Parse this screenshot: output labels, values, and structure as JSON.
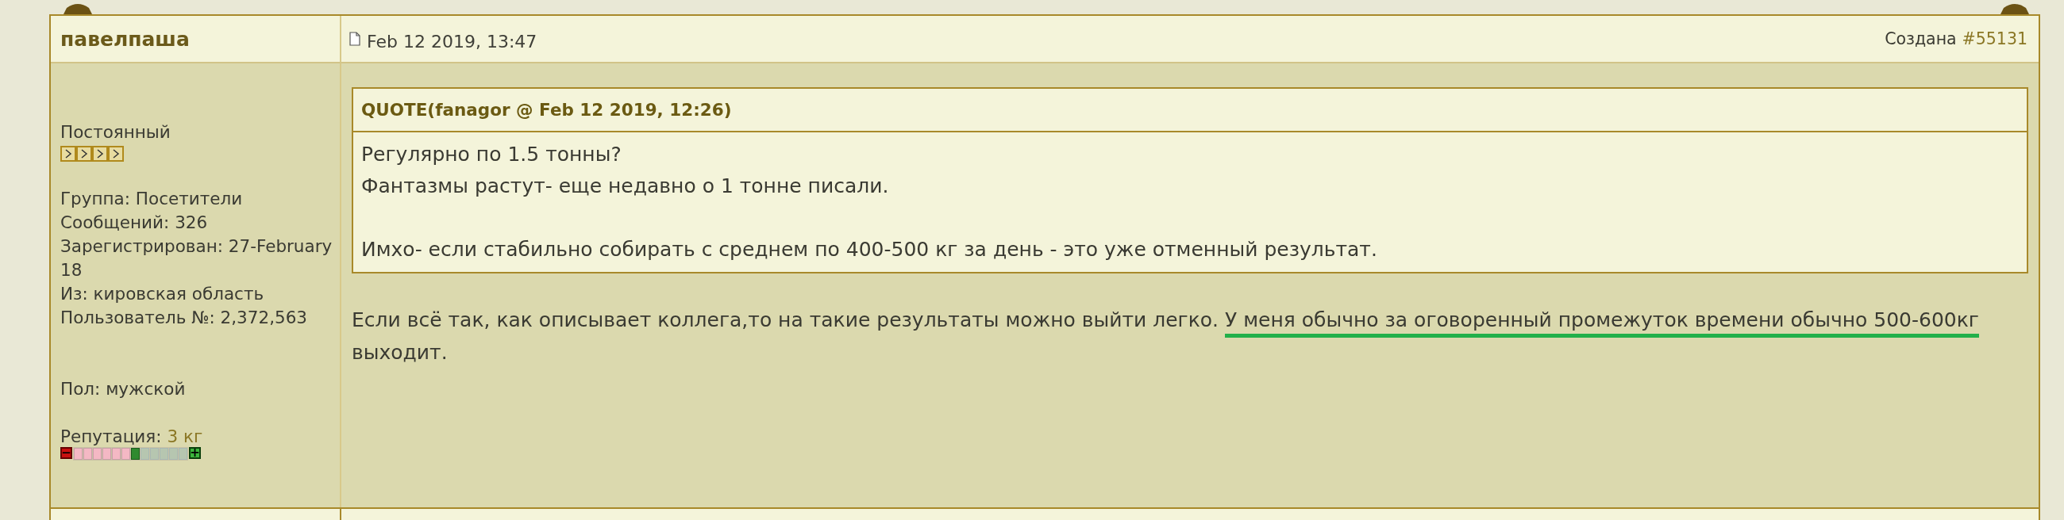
{
  "post": {
    "author": "павелпаша",
    "date": "Feb 12 2019, 13:47",
    "created_label": "Создана",
    "post_number": "#55131"
  },
  "profile": {
    "rank": {
      "title": "Постоянный"
    },
    "details": [
      "Группа: Посетители",
      "Сообщений: 326",
      "Зарегистрирован: 27-February 18",
      "Из: кировская область",
      "Пользователь №: 2,372,563"
    ],
    "gender": "Пол: мужской",
    "reputation": {
      "label": "Репутация:",
      "value": "3 кг",
      "level": 0.54,
      "minus": "−",
      "plus": "+"
    }
  },
  "quote": {
    "header": "QUOTE(fanagor @ Feb 12 2019, 12:26)",
    "paragraphs": [
      [
        "Регулярно по 1.5 тонны?",
        "Фантазмы растут- еще недавно о 1 тонне писали."
      ],
      [
        "Имхо- если стабильно собирать с среднем по 400-500 кг за день - это уже отменный результат."
      ]
    ]
  },
  "message": [
    {
      "kind": "plain",
      "text": "Если всё так, как описывает коллега,то на такие результаты можно выйти легко. "
    },
    {
      "kind": "underlined",
      "text": "У меня обычно за оговоренный промежуток времени обычно 500-600кг"
    },
    {
      "kind": "plain",
      "text": " выходит."
    }
  ]
}
